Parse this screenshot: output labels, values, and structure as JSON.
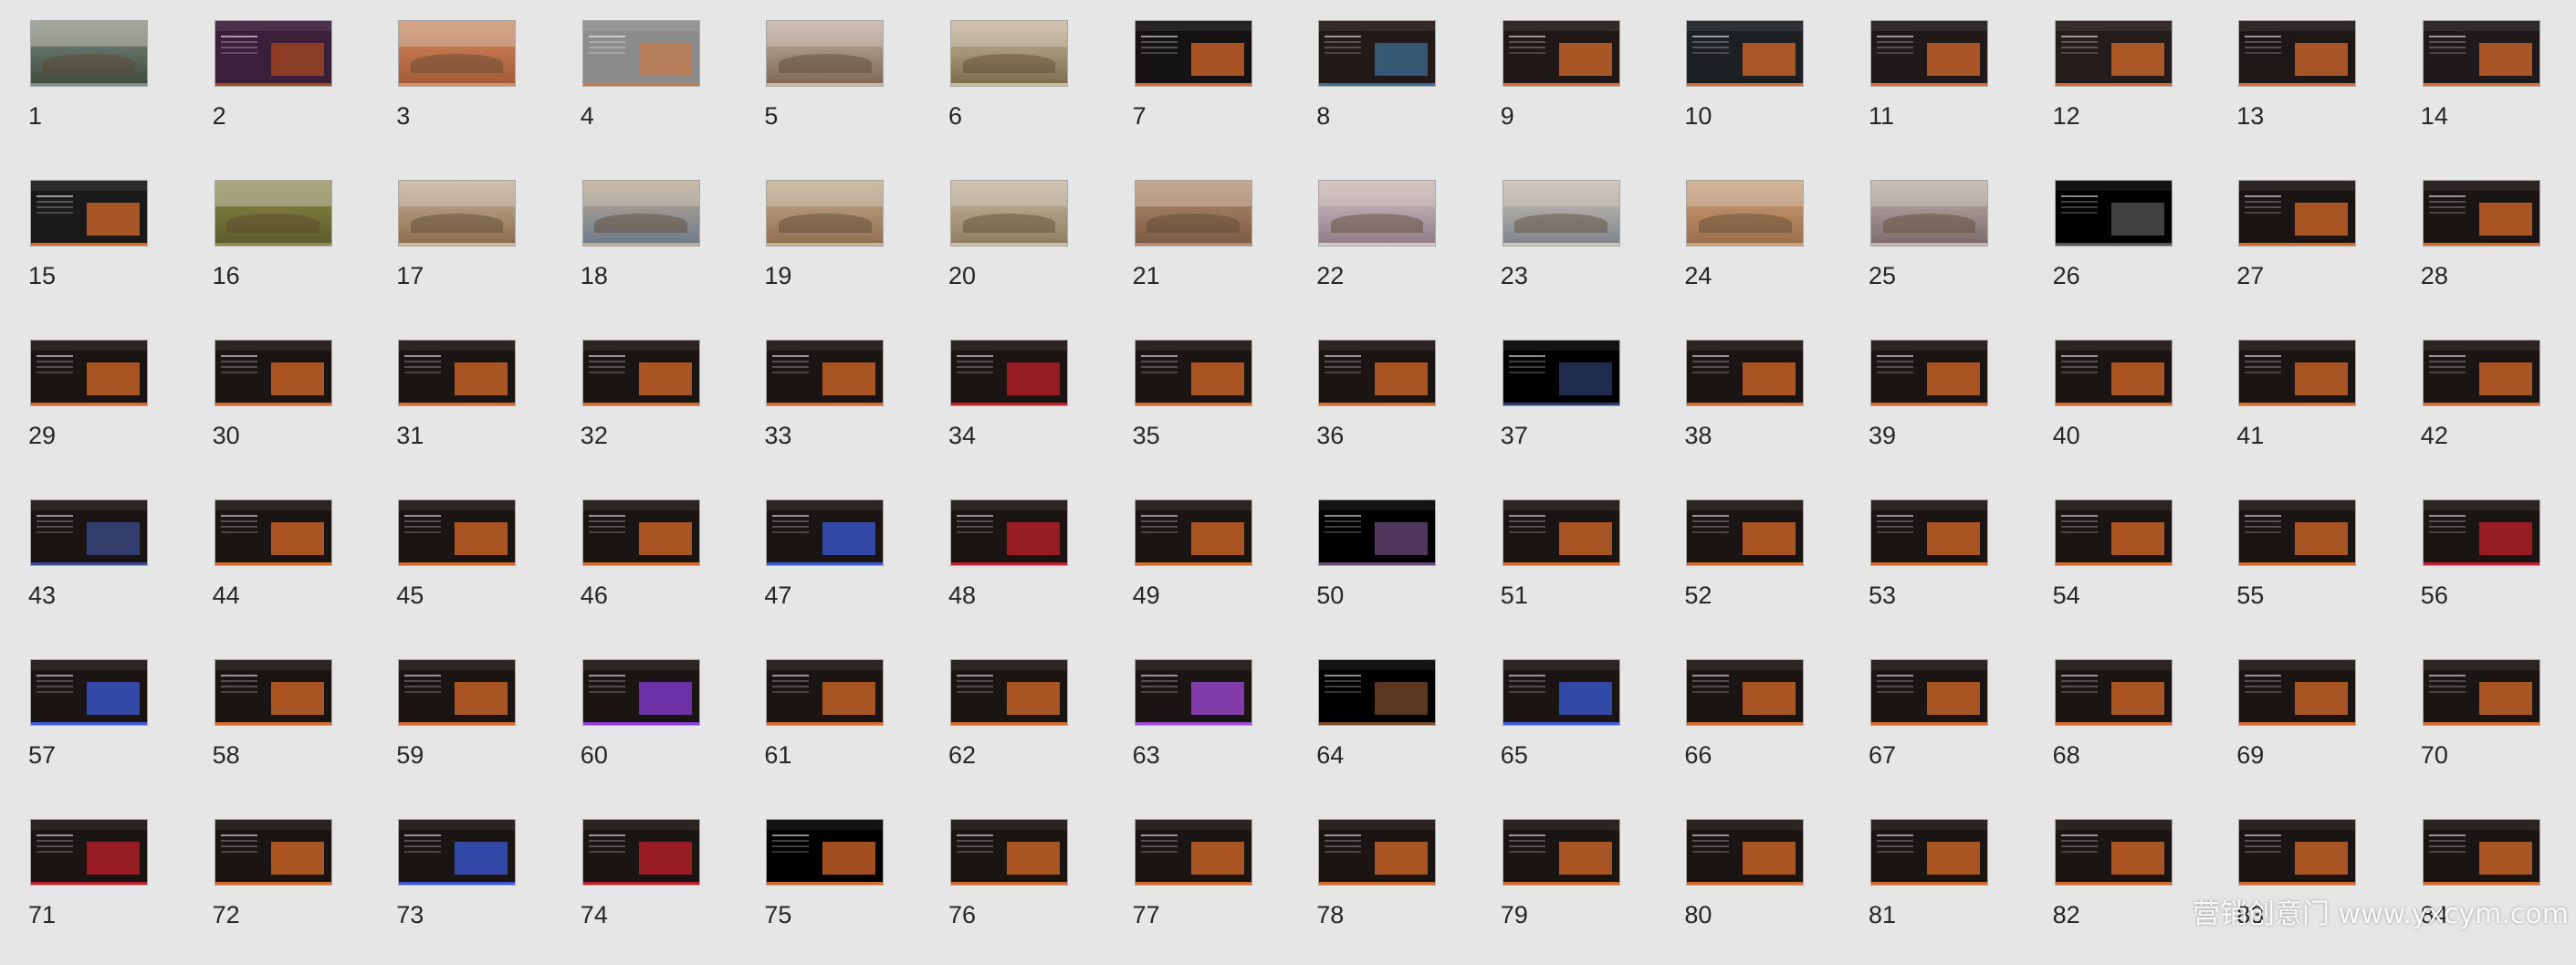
{
  "slides": [
    {
      "n": "1",
      "theme": "land",
      "c1": "#3f4a3b",
      "c2": "#7b8d86"
    },
    {
      "n": "2",
      "theme": "dark",
      "c1": "#3b1f3a",
      "c2": "#a84a1e"
    },
    {
      "n": "3",
      "theme": "land",
      "c1": "#a25a35",
      "c2": "#d98a5e"
    },
    {
      "n": "4",
      "theme": "grey",
      "c1": "#8c8c8c",
      "c2": "#c47a4a"
    },
    {
      "n": "5",
      "theme": "land",
      "c1": "#7e6552",
      "c2": "#c7b8aa"
    },
    {
      "n": "6",
      "theme": "land",
      "c1": "#7a6a4c",
      "c2": "#cbbf9e"
    },
    {
      "n": "7",
      "theme": "dark",
      "c1": "#151213",
      "c2": "#d86a2a"
    },
    {
      "n": "8",
      "theme": "dark",
      "c1": "#231917",
      "c2": "#3f6e94"
    },
    {
      "n": "9",
      "theme": "dark",
      "c1": "#1f1816",
      "c2": "#d86a2a"
    },
    {
      "n": "10",
      "theme": "dark",
      "c1": "#1d2023",
      "c2": "#d86a2a"
    },
    {
      "n": "11",
      "theme": "dark",
      "c1": "#1f1a19",
      "c2": "#d86a2a"
    },
    {
      "n": "12",
      "theme": "dark",
      "c1": "#241c1a",
      "c2": "#d86a2a"
    },
    {
      "n": "13",
      "theme": "dark",
      "c1": "#1d1716",
      "c2": "#d86a2a"
    },
    {
      "n": "14",
      "theme": "dark",
      "c1": "#1e1a1b",
      "c2": "#d86a2a"
    },
    {
      "n": "15",
      "theme": "dark",
      "c1": "#1a1a1a",
      "c2": "#d86a2a"
    },
    {
      "n": "16",
      "theme": "land",
      "c1": "#5a5a2a",
      "c2": "#8e8d4a"
    },
    {
      "n": "17",
      "theme": "land",
      "c1": "#8a6a4c",
      "c2": "#cbb89e"
    },
    {
      "n": "18",
      "theme": "land",
      "c1": "#6b7a8a",
      "c2": "#bfae96"
    },
    {
      "n": "19",
      "theme": "land",
      "c1": "#8e6d4d",
      "c2": "#c7b291"
    },
    {
      "n": "20",
      "theme": "land",
      "c1": "#8e7b5f",
      "c2": "#c9c0a6"
    },
    {
      "n": "21",
      "theme": "land",
      "c1": "#7a5a44",
      "c2": "#b78e6e"
    },
    {
      "n": "22",
      "theme": "land",
      "c1": "#8c7a86",
      "c2": "#d6c7c8"
    },
    {
      "n": "23",
      "theme": "land",
      "c1": "#7d8389",
      "c2": "#cfc8bd"
    },
    {
      "n": "24",
      "theme": "land",
      "c1": "#9a6d4b",
      "c2": "#d3a375"
    },
    {
      "n": "25",
      "theme": "land",
      "c1": "#7a6a6a",
      "c2": "#c2b6b2"
    },
    {
      "n": "26",
      "theme": "black",
      "c1": "#000000",
      "c2": "#555555"
    },
    {
      "n": "27",
      "theme": "dark",
      "c1": "#1a1412",
      "c2": "#d86a2a"
    },
    {
      "n": "28",
      "theme": "dark",
      "c1": "#1a1412",
      "c2": "#d86a2a"
    },
    {
      "n": "29",
      "theme": "dark",
      "c1": "#1a1412",
      "c2": "#d86a2a"
    },
    {
      "n": "30",
      "theme": "dark",
      "c1": "#1a1412",
      "c2": "#d86a2a"
    },
    {
      "n": "31",
      "theme": "dark",
      "c1": "#1a1412",
      "c2": "#d86a2a"
    },
    {
      "n": "32",
      "theme": "dark",
      "c1": "#1a1412",
      "c2": "#d86a2a"
    },
    {
      "n": "33",
      "theme": "dark",
      "c1": "#1a1412",
      "c2": "#d86a2a"
    },
    {
      "n": "34",
      "theme": "dark",
      "c1": "#1a1412",
      "c2": "#c21f2a"
    },
    {
      "n": "35",
      "theme": "dark",
      "c1": "#1a1412",
      "c2": "#d86a2a"
    },
    {
      "n": "36",
      "theme": "dark",
      "c1": "#1a1412",
      "c2": "#d86a2a"
    },
    {
      "n": "37",
      "theme": "black",
      "c1": "#000000",
      "c2": "#2a3a6a"
    },
    {
      "n": "38",
      "theme": "dark",
      "c1": "#1a1412",
      "c2": "#d86a2a"
    },
    {
      "n": "39",
      "theme": "dark",
      "c1": "#1a1412",
      "c2": "#d86a2a"
    },
    {
      "n": "40",
      "theme": "dark",
      "c1": "#1a1412",
      "c2": "#d86a2a"
    },
    {
      "n": "41",
      "theme": "dark",
      "c1": "#1a1412",
      "c2": "#d86a2a"
    },
    {
      "n": "42",
      "theme": "dark",
      "c1": "#1a1412",
      "c2": "#d86a2a"
    },
    {
      "n": "43",
      "theme": "dark",
      "c1": "#1a1412",
      "c2": "#3d4c8e"
    },
    {
      "n": "44",
      "theme": "dark",
      "c1": "#1a1412",
      "c2": "#d86a2a"
    },
    {
      "n": "45",
      "theme": "dark",
      "c1": "#1a1412",
      "c2": "#d86a2a"
    },
    {
      "n": "46",
      "theme": "dark",
      "c1": "#1a1412",
      "c2": "#d86a2a"
    },
    {
      "n": "47",
      "theme": "dark",
      "c1": "#1a1412",
      "c2": "#3b5bd9"
    },
    {
      "n": "48",
      "theme": "dark",
      "c1": "#1a1412",
      "c2": "#c21f2a"
    },
    {
      "n": "49",
      "theme": "dark",
      "c1": "#1a1412",
      "c2": "#d86a2a"
    },
    {
      "n": "50",
      "theme": "black",
      "c1": "#000000",
      "c2": "#6a4a7a"
    },
    {
      "n": "51",
      "theme": "dark",
      "c1": "#1a1412",
      "c2": "#d86a2a"
    },
    {
      "n": "52",
      "theme": "dark",
      "c1": "#1a1412",
      "c2": "#d86a2a"
    },
    {
      "n": "53",
      "theme": "dark",
      "c1": "#1a1412",
      "c2": "#d86a2a"
    },
    {
      "n": "54",
      "theme": "dark",
      "c1": "#1a1412",
      "c2": "#d86a2a"
    },
    {
      "n": "55",
      "theme": "dark",
      "c1": "#1a1412",
      "c2": "#d86a2a"
    },
    {
      "n": "56",
      "theme": "dark",
      "c1": "#1a1412",
      "c2": "#c21f2a"
    },
    {
      "n": "57",
      "theme": "dark",
      "c1": "#1a1412",
      "c2": "#3b5bd9"
    },
    {
      "n": "58",
      "theme": "dark",
      "c1": "#1a1412",
      "c2": "#d86a2a"
    },
    {
      "n": "59",
      "theme": "dark",
      "c1": "#1a1412",
      "c2": "#d86a2a"
    },
    {
      "n": "60",
      "theme": "dark",
      "c1": "#1a1412",
      "c2": "#8a3bd9"
    },
    {
      "n": "61",
      "theme": "dark",
      "c1": "#1a1412",
      "c2": "#d86a2a"
    },
    {
      "n": "62",
      "theme": "dark",
      "c1": "#1a1412",
      "c2": "#d86a2a"
    },
    {
      "n": "63",
      "theme": "dark",
      "c1": "#1a1412",
      "c2": "#a44ad9"
    },
    {
      "n": "64",
      "theme": "black",
      "c1": "#000000",
      "c2": "#7a4a2a"
    },
    {
      "n": "65",
      "theme": "dark",
      "c1": "#1a1412",
      "c2": "#3b5bd9"
    },
    {
      "n": "66",
      "theme": "dark",
      "c1": "#1a1412",
      "c2": "#d86a2a"
    },
    {
      "n": "67",
      "theme": "dark",
      "c1": "#1a1412",
      "c2": "#d86a2a"
    },
    {
      "n": "68",
      "theme": "dark",
      "c1": "#1a1412",
      "c2": "#d86a2a"
    },
    {
      "n": "69",
      "theme": "dark",
      "c1": "#1a1412",
      "c2": "#d86a2a"
    },
    {
      "n": "70",
      "theme": "dark",
      "c1": "#1a1412",
      "c2": "#d86a2a"
    },
    {
      "n": "71",
      "theme": "dark",
      "c1": "#1a1412",
      "c2": "#c21f2a"
    },
    {
      "n": "72",
      "theme": "dark",
      "c1": "#1a1412",
      "c2": "#d86a2a"
    },
    {
      "n": "73",
      "theme": "dark",
      "c1": "#1a1412",
      "c2": "#3b5bd9"
    },
    {
      "n": "74",
      "theme": "dark",
      "c1": "#1a1412",
      "c2": "#c21f2a"
    },
    {
      "n": "75",
      "theme": "black",
      "c1": "#000000",
      "c2": "#d86a2a"
    },
    {
      "n": "76",
      "theme": "dark",
      "c1": "#1a1412",
      "c2": "#d86a2a"
    },
    {
      "n": "77",
      "theme": "dark",
      "c1": "#1a1412",
      "c2": "#d86a2a"
    },
    {
      "n": "78",
      "theme": "dark",
      "c1": "#1a1412",
      "c2": "#d86a2a"
    },
    {
      "n": "79",
      "theme": "dark",
      "c1": "#1a1412",
      "c2": "#d86a2a"
    },
    {
      "n": "80",
      "theme": "dark",
      "c1": "#1a1412",
      "c2": "#d86a2a"
    },
    {
      "n": "81",
      "theme": "dark",
      "c1": "#1a1412",
      "c2": "#d86a2a"
    },
    {
      "n": "82",
      "theme": "dark",
      "c1": "#1a1412",
      "c2": "#d86a2a"
    },
    {
      "n": "83",
      "theme": "dark",
      "c1": "#1a1412",
      "c2": "#d86a2a"
    },
    {
      "n": "84",
      "theme": "dark",
      "c1": "#1a1412",
      "c2": "#d86a2a"
    }
  ],
  "watermark": "营销创意门 www.yxcym.com"
}
